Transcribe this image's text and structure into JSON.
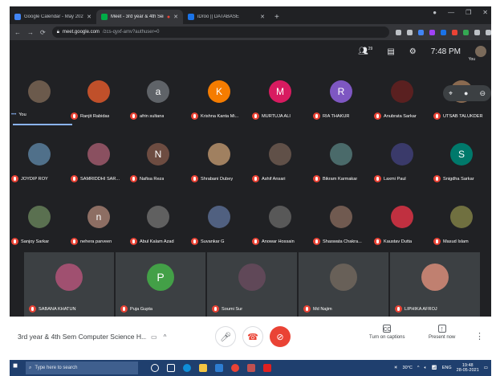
{
  "browser": {
    "tabs": [
      {
        "title": "Google Calendar - May 2021",
        "color": "#4285f4"
      },
      {
        "title": "Meet - 3rd year & 4th Sem C",
        "color": "#00ac47"
      },
      {
        "title": "iDroo || DATABASE",
        "color": "#1a73e8"
      }
    ],
    "new_tab": "+",
    "url_host": "meet.google.com",
    "url_path": "/zcs-qyxf-amv?authuser=0"
  },
  "meet_top": {
    "participants_count": "29",
    "time": "7:48 PM",
    "you_label": "You"
  },
  "participants": [
    {
      "name": "You",
      "initial": "",
      "color": "#6b5a4c"
    },
    {
      "name": "Ranjit Rabidas",
      "initial": "",
      "color": "#c0502a"
    },
    {
      "name": "afrin sultana",
      "initial": "a",
      "color": "#5f6368"
    },
    {
      "name": "Krishna Kanta Mi...",
      "initial": "K",
      "color": "#f57c00"
    },
    {
      "name": "MURTUJA ALI",
      "initial": "M",
      "color": "#d81b60"
    },
    {
      "name": "RIA THAKUR",
      "initial": "R",
      "color": "#7e57c2"
    },
    {
      "name": "Anubrata Sarkar",
      "initial": "",
      "color": "#5a2020"
    },
    {
      "name": "UTSAB TALUKDER",
      "initial": "",
      "color": "#8a6a50"
    },
    {
      "name": "JOYDIP ROY",
      "initial": "",
      "color": "#50708a"
    },
    {
      "name": "SAMRIDDHI SAR...",
      "initial": "",
      "color": "#8a5060"
    },
    {
      "name": "Nafisa Reza",
      "initial": "N",
      "color": "#6d4c41"
    },
    {
      "name": "Shrabani Dubey",
      "initial": "",
      "color": "#a08060"
    },
    {
      "name": "Ashif Ansari",
      "initial": "",
      "color": "#605048"
    },
    {
      "name": "Bikram Karmakar",
      "initial": "",
      "color": "#4a6a6a"
    },
    {
      "name": "Laxmi Paul",
      "initial": "",
      "color": "#3a3a6a"
    },
    {
      "name": "Snigdha Sarkar",
      "initial": "S",
      "color": "#00796b"
    },
    {
      "name": "Sanjoy Sarkar",
      "initial": "",
      "color": "#5a7050"
    },
    {
      "name": "nehera parveen",
      "initial": "n",
      "color": "#8d6e63"
    },
    {
      "name": "Abul Kalam Azad",
      "initial": "",
      "color": "#606060"
    },
    {
      "name": "Suvankar G",
      "initial": "",
      "color": "#506080"
    },
    {
      "name": "Anowar Hossain",
      "initial": "",
      "color": "#585858"
    },
    {
      "name": "Shaswata Chakra...",
      "initial": "",
      "color": "#705a50"
    },
    {
      "name": "Kaustav Dutta",
      "initial": "",
      "color": "#c03040"
    },
    {
      "name": "Masud Islam",
      "initial": "",
      "color": "#707040"
    }
  ],
  "large_tiles": [
    {
      "name": "SABANA KHATUN",
      "initial": "",
      "color": "#a05070"
    },
    {
      "name": "Puja Gupta",
      "initial": "P",
      "color": "#43a047"
    },
    {
      "name": "Soumi Sur",
      "initial": "",
      "color": "#604858"
    },
    {
      "name": "Md Najim",
      "initial": "",
      "color": "#686058"
    },
    {
      "name": "LIPHIKA AFROJ",
      "initial": "",
      "color": "#c08070"
    }
  ],
  "bottom": {
    "meeting_title": "3rd year & 4th Sem Computer Science H...",
    "captions_label": "Turn on captions",
    "present_label": "Present now"
  },
  "taskbar": {
    "search_placeholder": "Type here to search",
    "temperature": "30°C",
    "lang": "ENG",
    "clock_time": "19:48",
    "clock_date": "28-05-2021"
  }
}
